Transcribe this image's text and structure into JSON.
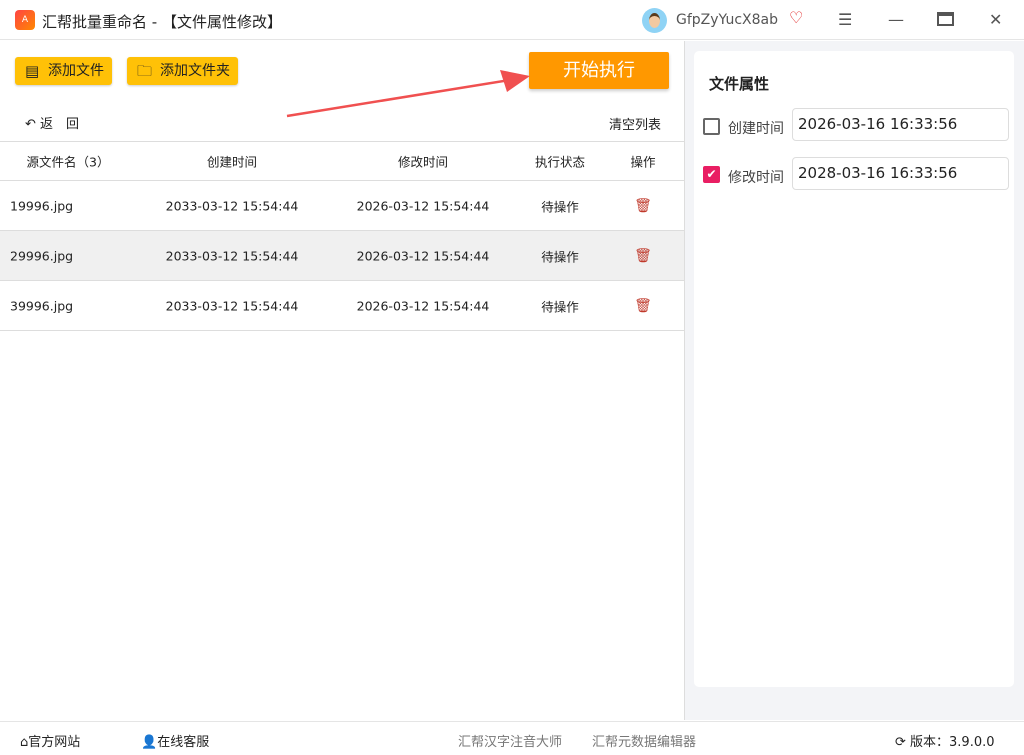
{
  "window": {
    "title": "汇帮批量重命名 - 【文件属性修改】",
    "logo_text": "A",
    "user": "GfpZyYucX8ab"
  },
  "toolbar": {
    "add_file": "添加文件",
    "add_folder": "添加文件夹",
    "start": "开始执行",
    "back": "返　回",
    "clear": "清空列表"
  },
  "table": {
    "headers": [
      "源文件名（3）",
      "创建时间",
      "修改时间",
      "执行状态",
      "操作"
    ],
    "rows": [
      {
        "name": "19996.jpg",
        "created": "2033-03-12 15:54:44",
        "modified": "2026-03-12 15:54:44",
        "status": "待操作"
      },
      {
        "name": "29996.jpg",
        "created": "2033-03-12 15:54:44",
        "modified": "2026-03-12 15:54:44",
        "status": "待操作"
      },
      {
        "name": "39996.jpg",
        "created": "2033-03-12 15:54:44",
        "modified": "2026-03-12 15:54:44",
        "status": "待操作"
      }
    ]
  },
  "panel": {
    "title": "文件属性",
    "create_label": "创建时间",
    "create_value": "2026-03-16 16:33:56",
    "create_checked": false,
    "modify_label": "修改时间",
    "modify_value": "2028-03-16 16:33:56",
    "modify_checked": true
  },
  "footer": {
    "website": "官方网站",
    "support": "在线客服",
    "link1": "汇帮汉字注音大师",
    "link2": "汇帮元数据编辑器",
    "version": "版本：3.9.0.0"
  }
}
